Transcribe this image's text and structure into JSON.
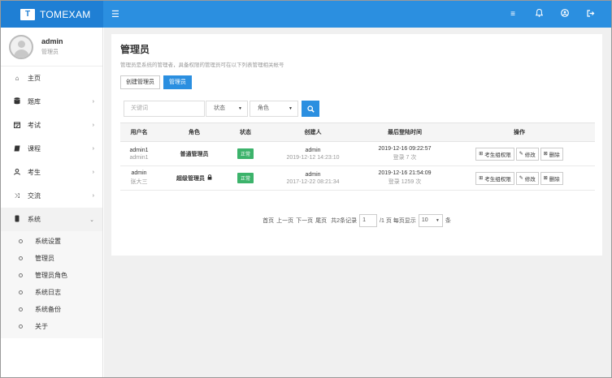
{
  "app": {
    "logo_glyph": "T",
    "name": "TOMEXAM",
    "menu_toggle_icon": "hamburger-icon"
  },
  "top_icons": [
    "list-icon",
    "bell-icon",
    "user-circle-icon",
    "logout-icon"
  ],
  "profile": {
    "name": "admin",
    "role": "管理员"
  },
  "sidebar": {
    "items": [
      {
        "label": "主页",
        "icon": "home-icon",
        "has_arrow": false
      },
      {
        "label": "题库",
        "icon": "database-icon",
        "has_arrow": true
      },
      {
        "label": "考试",
        "icon": "calendar-check-icon",
        "has_arrow": true
      },
      {
        "label": "课程",
        "icon": "book-icon",
        "has_arrow": true
      },
      {
        "label": "考生",
        "icon": "user-icon",
        "has_arrow": true
      },
      {
        "label": "交流",
        "icon": "shuffle-icon",
        "has_arrow": true
      },
      {
        "label": "系统",
        "icon": "server-icon",
        "has_arrow": true,
        "expanded": true
      }
    ],
    "sub_items": [
      "系统设置",
      "管理员",
      "管理员角色",
      "系统日志",
      "系统备份",
      "关于"
    ]
  },
  "main": {
    "title": "管理员",
    "description": "管理员是系统的管理者，具备权限的管理员可在以下列表管理相关帐号",
    "tabs": [
      {
        "label": "创建管理员",
        "active": false
      },
      {
        "label": "管理员",
        "active": true
      }
    ],
    "filters": {
      "keyword_placeholder": "关键词",
      "status_label": "状态",
      "role_label": "角色",
      "search_icon": "search-icon"
    },
    "table": {
      "headers": [
        "用户名",
        "角色",
        "状态",
        "创建人",
        "最后登陆时间",
        "操作"
      ],
      "rows": [
        {
          "username": "admin1",
          "username_sub": "admin1",
          "role": "普通管理员",
          "role_locked": false,
          "status": "正常",
          "creator": "admin",
          "created_at": "2019-12-12 14:23:10",
          "last_login": "2019-12-16 09:22:57",
          "login_count": "登录 7 次"
        },
        {
          "username": "admin",
          "username_sub": "张大三",
          "role": "超级管理员",
          "role_locked": true,
          "status": "正常",
          "creator": "admin",
          "created_at": "2017-12-22 08:21:34",
          "last_login": "2019-12-16 21:54:09",
          "login_count": "登录 1259 次"
        }
      ],
      "actions": [
        {
          "label": "考生组权限",
          "icon": "sitemap-icon"
        },
        {
          "label": "修改",
          "icon": "wrench-icon"
        },
        {
          "label": "删除",
          "icon": "close-box-icon"
        }
      ]
    },
    "pager": {
      "first": "首页",
      "prev": "上一页",
      "next": "下一页",
      "last": "尾页",
      "total": "共2条记录",
      "page_value": "1",
      "pages_text": "/1 页 每页显示",
      "page_size": "10",
      "unit": "条"
    }
  },
  "colors": {
    "primary": "#2b8fe0",
    "brand_dark": "#1f7fd4",
    "success": "#3cb36b"
  }
}
